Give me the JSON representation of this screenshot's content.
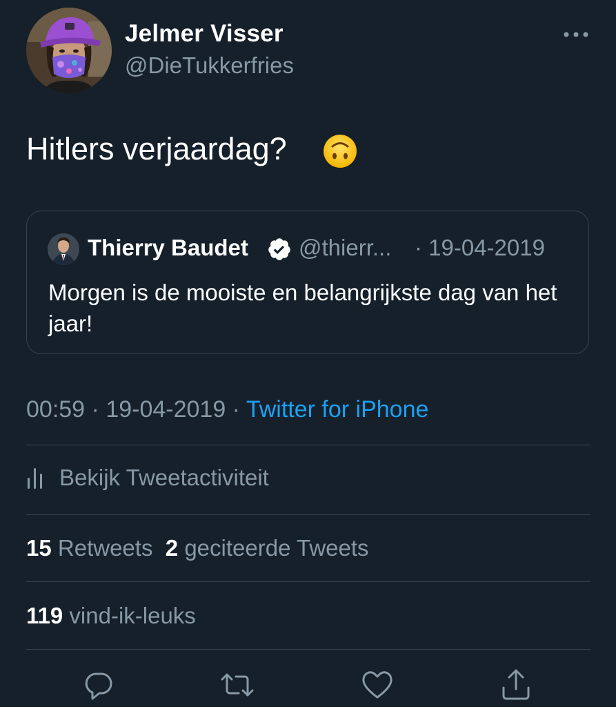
{
  "author": {
    "name": "Jelmer Visser",
    "handle": "@DieTukkerfries"
  },
  "tweet": {
    "text": "Hitlers verjaardag?",
    "emoji": "upside-down-face-emoji"
  },
  "quoted": {
    "name": "Thierry Baudet",
    "handle": "@thierr...",
    "date": "· 19-04-2019",
    "text": "Morgen is de mooiste en belangrijkste dag van het jaar!",
    "verified_icon": "verified-badge-icon"
  },
  "meta": {
    "time": "00:59",
    "sep1": " · ",
    "date": "19-04-2019",
    "sep2": " · ",
    "source": "Twitter for iPhone"
  },
  "activity": {
    "label": "Bekijk Tweetactiviteit",
    "icon": "bar-chart-icon"
  },
  "stats": {
    "retweets_count": "15",
    "retweets_label": "Retweets",
    "quotes_count": "2",
    "quotes_label": "geciteerde Tweets",
    "likes_count": "119",
    "likes_label": "vind-ik-leuks"
  },
  "actions": [
    {
      "name": "reply",
      "icon": "reply-bubble-icon"
    },
    {
      "name": "retweet",
      "icon": "retweet-arrows-icon"
    },
    {
      "name": "like",
      "icon": "heart-icon"
    },
    {
      "name": "share",
      "icon": "share-upload-icon"
    }
  ],
  "colors": {
    "background": "#15202b",
    "secondary_text": "#8899a6",
    "link": "#1da1f2",
    "border": "#38444d",
    "verified": "#ffffff"
  }
}
